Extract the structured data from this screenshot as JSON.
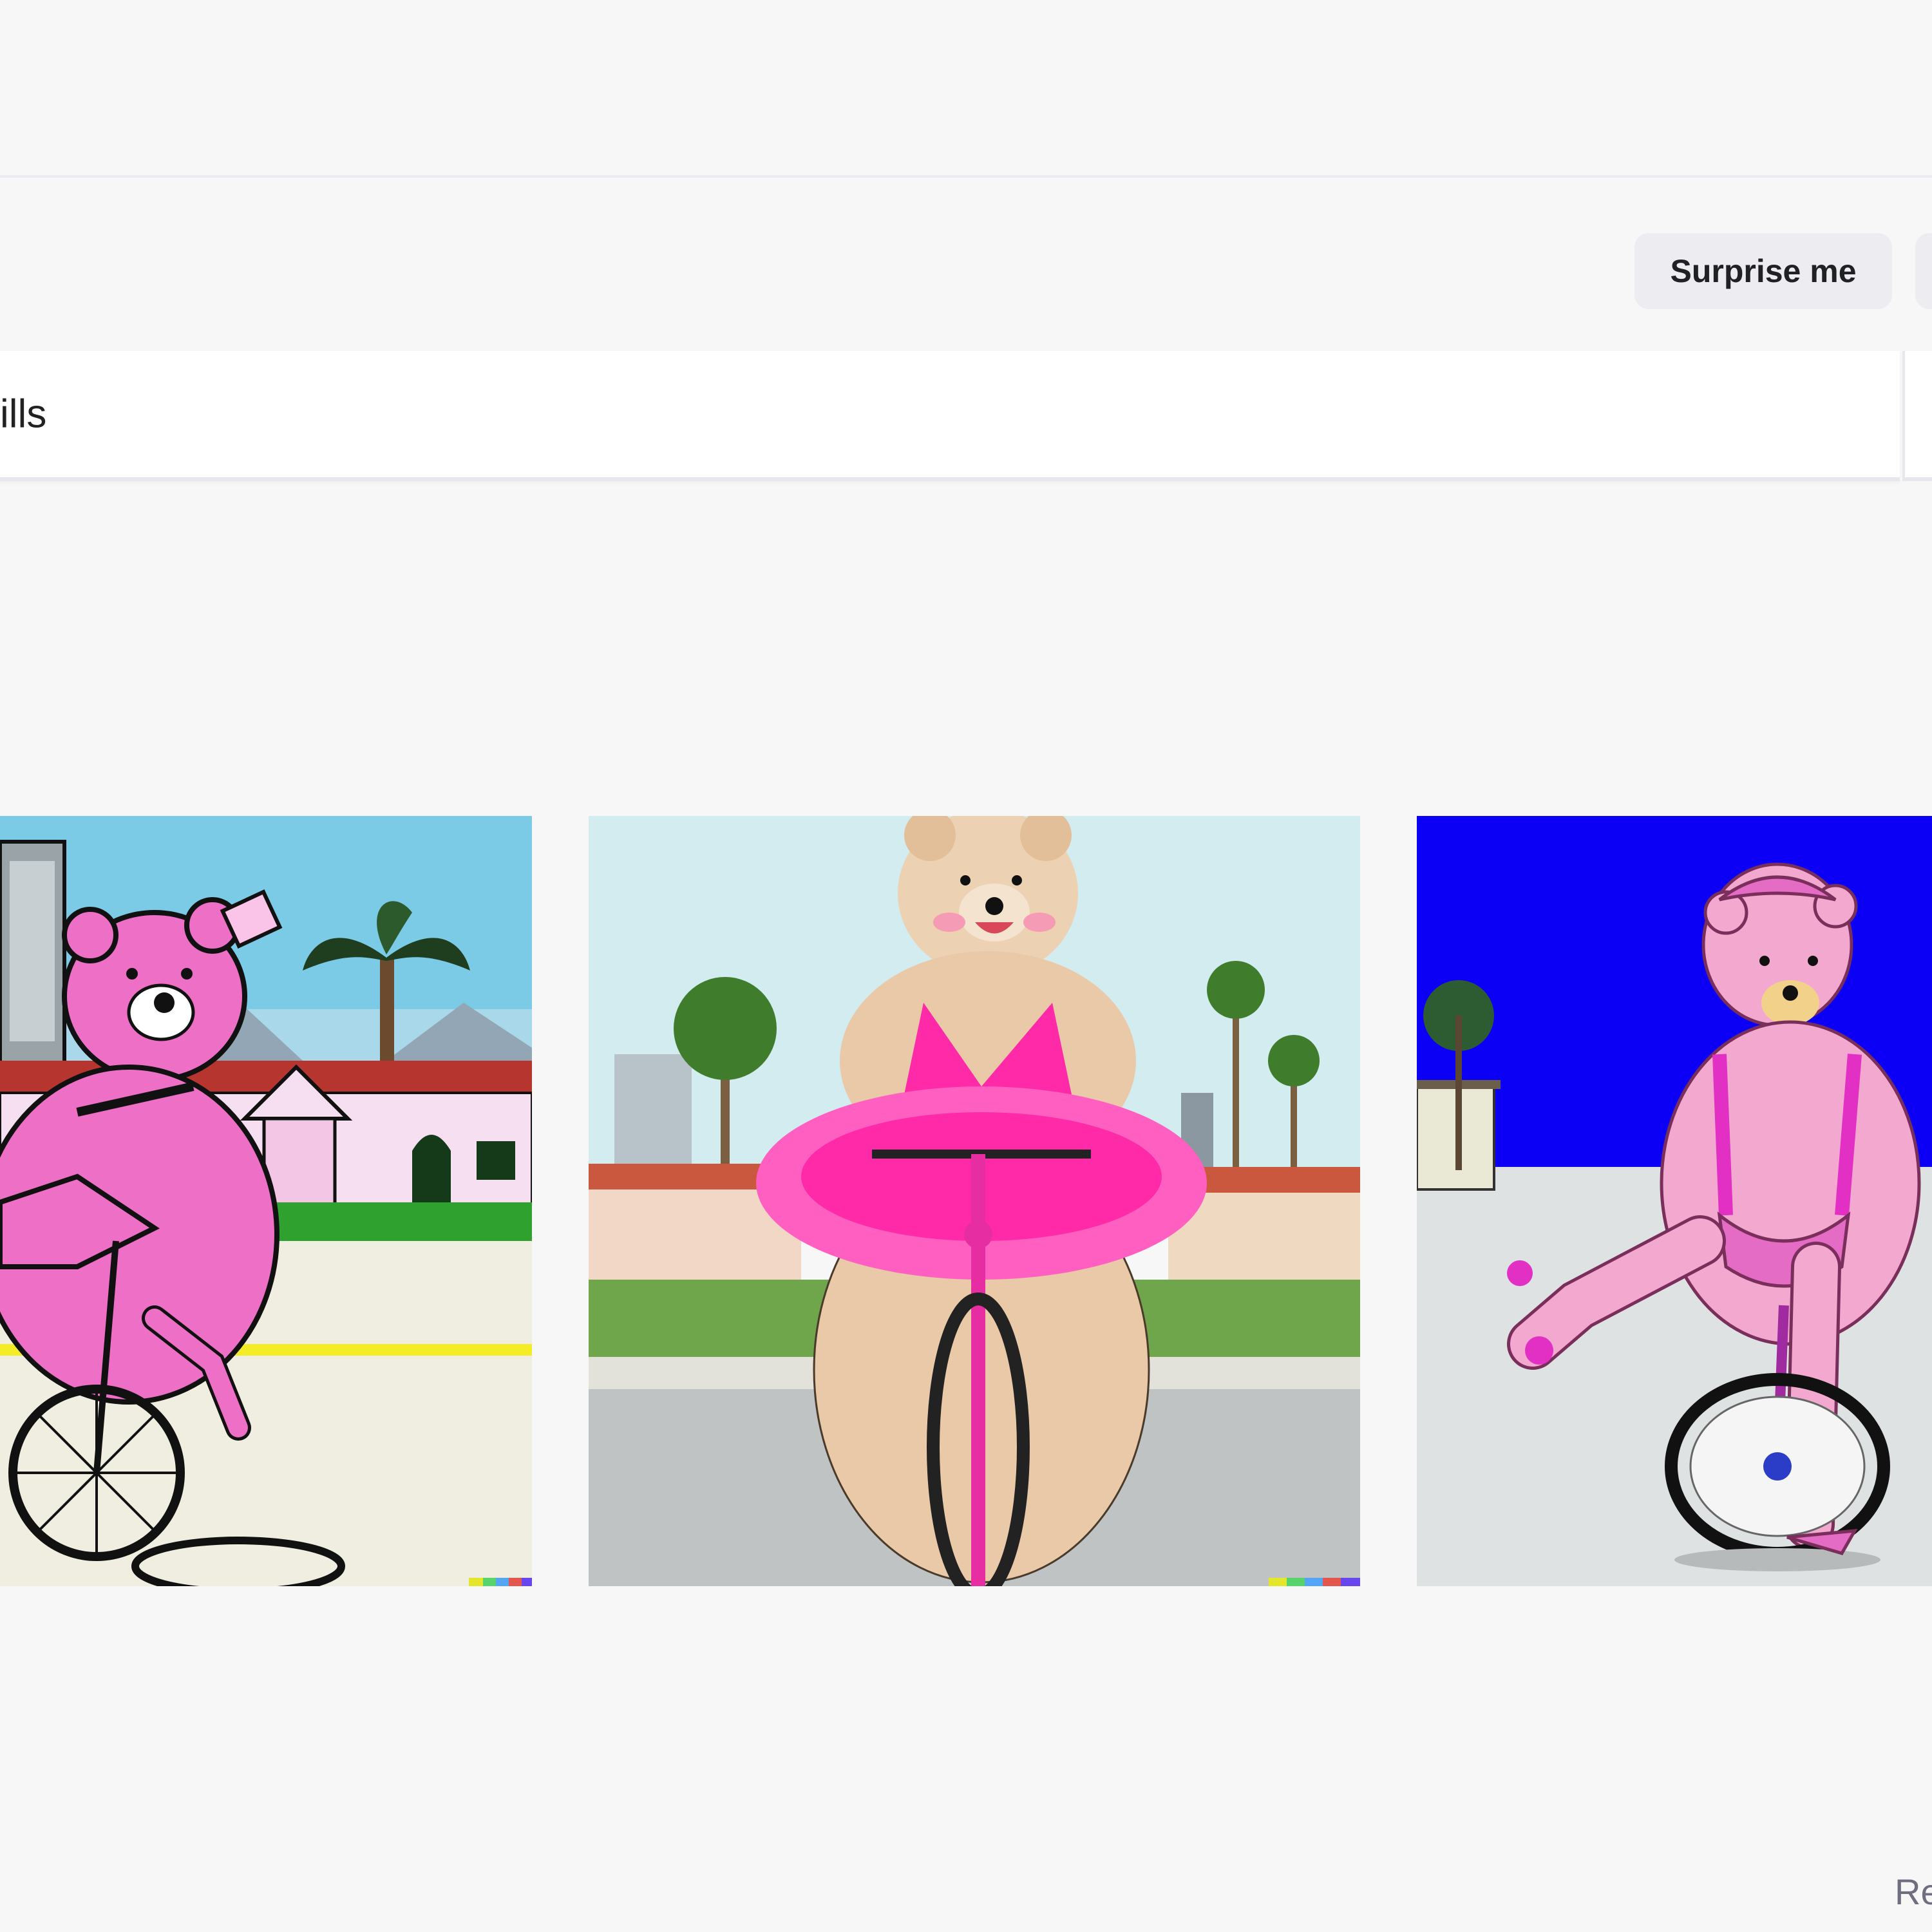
{
  "header": {
    "surprise_label": "Surprise me"
  },
  "prompt": {
    "value": "ills"
  },
  "gallery": {
    "images": [
      {
        "icon": "pink-bear-unicycle-illustration"
      },
      {
        "icon": "bear-pink-tutu-bicycle-painting"
      },
      {
        "icon": "pink-bear-unicycle-blue-sky"
      }
    ]
  },
  "footer": {
    "partial_text": "Re"
  },
  "colors": {
    "page_bg": "#f7f7f8",
    "button_bg": "#ececf1",
    "text_primary": "#202123",
    "text_muted": "#6e6e80",
    "pink": "#ee6fc6",
    "hot_pink": "#ff2aa7",
    "blue_sky": "#0b00f5"
  }
}
